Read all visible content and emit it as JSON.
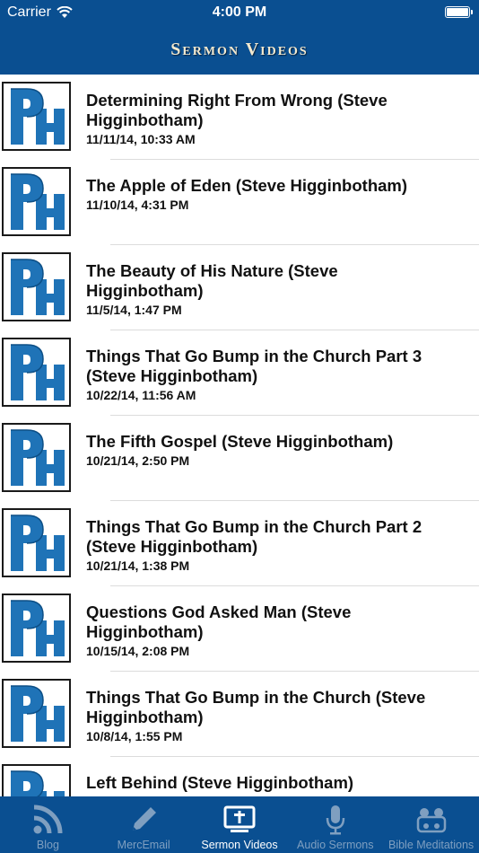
{
  "status_bar": {
    "carrier": "Carrier",
    "time": "4:00 PM"
  },
  "nav": {
    "title": "Sermon Videos"
  },
  "thumbnail": {
    "icon": "ph-logo-icon",
    "color": "#1f73b7"
  },
  "videos": [
    {
      "title": "Determining Right From Wrong (Steve Higginbotham)",
      "date": "11/11/14, 10:33 AM"
    },
    {
      "title": "The Apple of Eden (Steve Higginbotham)",
      "date": "11/10/14, 4:31 PM"
    },
    {
      "title": "The Beauty of His Nature (Steve Higginbotham)",
      "date": "11/5/14, 1:47 PM"
    },
    {
      "title": "Things That Go Bump in the Church Part 3 (Steve Higginbotham)",
      "date": "10/22/14, 11:56 AM"
    },
    {
      "title": "The Fifth Gospel (Steve Higginbotham)",
      "date": "10/21/14, 2:50 PM"
    },
    {
      "title": "Things That Go Bump in the Church Part 2 (Steve Higginbotham)",
      "date": "10/21/14, 1:38 PM"
    },
    {
      "title": "Questions God Asked Man (Steve Higginbotham)",
      "date": "10/15/14, 2:08 PM"
    },
    {
      "title": "Things That Go Bump in the Church (Steve Higginbotham)",
      "date": "10/8/14, 1:55 PM"
    },
    {
      "title": "Left Behind (Steve Higginbotham)",
      "date": ""
    }
  ],
  "tabs": [
    {
      "label": "Blog",
      "icon": "rss-icon",
      "active": false
    },
    {
      "label": "MercEmail",
      "icon": "pencil-icon",
      "active": false
    },
    {
      "label": "Sermon Videos",
      "icon": "video-screen-icon",
      "active": true
    },
    {
      "label": "Audio Sermons",
      "icon": "microphone-icon",
      "active": false
    },
    {
      "label": "Bible Meditations",
      "icon": "group-icon",
      "active": false
    }
  ],
  "colors": {
    "brand": "#0a4f91",
    "title_text": "#f4ead0",
    "tab_inactive": "#7f9fc0",
    "tab_active": "#ffffff"
  }
}
